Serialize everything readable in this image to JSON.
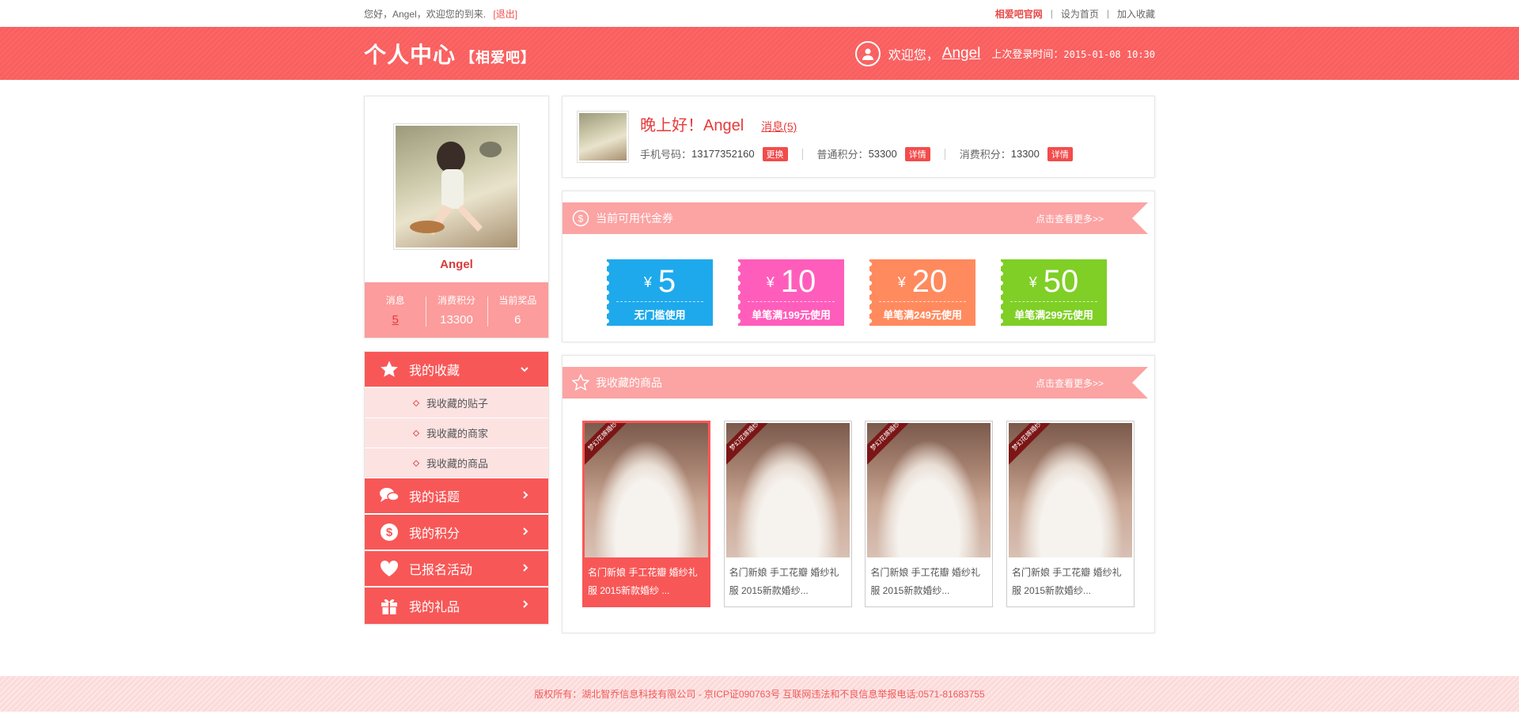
{
  "topbar": {
    "greeting": "您好，Angel，欢迎您的到来.",
    "logout": "[退出]",
    "brand": "相爱吧官网",
    "set_home": "设为首页",
    "favorite": "加入收藏"
  },
  "header": {
    "title": "个人中心",
    "subtitle": "【相爱吧】",
    "welcome": "欢迎您，",
    "username": "Angel",
    "last_login_label": "上次登录时间：",
    "last_login_time": "2015-01-08 10:30"
  },
  "profile": {
    "name": "Angel",
    "stats": [
      {
        "label": "消息",
        "value": "5"
      },
      {
        "label": "消费积分",
        "value": "13300"
      },
      {
        "label": "当前奖品",
        "value": "6"
      }
    ]
  },
  "menu": {
    "favorites": "我的收藏",
    "sub_items": [
      "我收藏的贴子",
      "我收藏的商家",
      "我收藏的商品"
    ],
    "topics": "我的话题",
    "points": "我的积分",
    "events": "已报名活动",
    "gifts": "我的礼品"
  },
  "hello": {
    "greeting": "晚上好！Angel",
    "messages": "消息(5)",
    "phone_label": "手机号码：",
    "phone": "13177352160",
    "phone_btn": "更换",
    "normal_points_label": "普通积分：",
    "normal_points": "53300",
    "consume_points_label": "消费积分：",
    "consume_points": "13300",
    "detail_btn": "详情"
  },
  "coupons": {
    "title": "当前可用代金券",
    "more": "点击查看更多>>",
    "currency": "¥",
    "items": [
      {
        "amount": "5",
        "condition": "无门槛使用",
        "color": "#1ea9ec"
      },
      {
        "amount": "10",
        "condition": "单笔满199元使用",
        "color": "#ff5dbb"
      },
      {
        "amount": "20",
        "condition": "单笔满249元使用",
        "color": "#ff8a5e"
      },
      {
        "amount": "50",
        "condition": "单笔满299元使用",
        "color": "#7fcf26"
      }
    ]
  },
  "goods": {
    "title": "我收藏的商品",
    "more": "点击查看更多>>",
    "badge": "梦幻花嫁婚纱",
    "items": [
      "名门新娘 手工花瓣 婚纱礼服 2015新款婚纱 ...",
      "名门新娘 手工花瓣 婚纱礼服 2015新款婚纱...",
      "名门新娘 手工花瓣 婚纱礼服 2015新款婚纱...",
      "名门新娘 手工花瓣 婚纱礼服 2015新款婚纱..."
    ]
  },
  "footer": {
    "text": "版权所有：湖北智乔信息科技有限公司 - 京ICP证090763号 互联网违法和不良信息举报电话:0571-81683755"
  }
}
